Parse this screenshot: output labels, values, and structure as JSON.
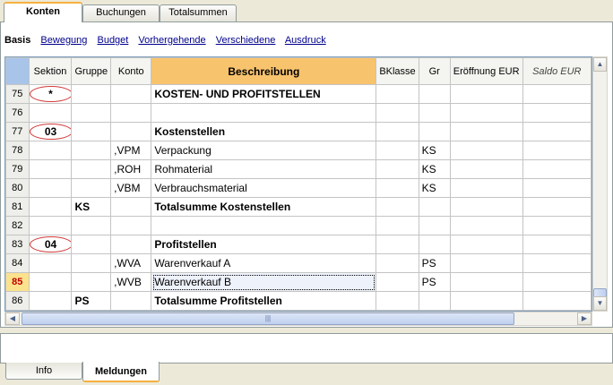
{
  "tabs": [
    {
      "label": "Konten",
      "active": true
    },
    {
      "label": "Buchungen",
      "active": false
    },
    {
      "label": "Totalsummen",
      "active": false
    }
  ],
  "views": {
    "current": "Basis",
    "links": [
      "Bewegung",
      "Budget",
      "Vorhergehende",
      "Verschiedene",
      "Ausdruck"
    ]
  },
  "table": {
    "columns": [
      "Sektion",
      "Gruppe",
      "Konto",
      "Beschreibung",
      "BKlasse",
      "Gr",
      "Eröffnung EUR",
      "Saldo EUR"
    ],
    "rows": [
      {
        "n": "75",
        "sektion": "*",
        "gruppe": "",
        "konto": "",
        "desc": "KOSTEN- UND PROFITSTELLEN",
        "bklasse": "",
        "gr": "",
        "bold": true
      },
      {
        "n": "76",
        "sektion": "",
        "gruppe": "",
        "konto": "",
        "desc": "",
        "bklasse": "",
        "gr": ""
      },
      {
        "n": "77",
        "sektion": "03",
        "gruppe": "",
        "konto": "",
        "desc": "Kostenstellen",
        "bklasse": "",
        "gr": "",
        "bold": true
      },
      {
        "n": "78",
        "sektion": "",
        "gruppe": "",
        "konto": ",VPM",
        "desc": "Verpackung",
        "bklasse": "",
        "gr": "KS"
      },
      {
        "n": "79",
        "sektion": "",
        "gruppe": "",
        "konto": ",ROH",
        "desc": "Rohmaterial",
        "bklasse": "",
        "gr": "KS"
      },
      {
        "n": "80",
        "sektion": "",
        "gruppe": "",
        "konto": ",VBM",
        "desc": "Verbrauchsmaterial",
        "bklasse": "",
        "gr": "KS"
      },
      {
        "n": "81",
        "sektion": "",
        "gruppe": "KS",
        "konto": "",
        "desc": "Totalsumme Kostenstellen",
        "bklasse": "",
        "gr": "",
        "bold": true
      },
      {
        "n": "82",
        "sektion": "",
        "gruppe": "",
        "konto": "",
        "desc": "",
        "bklasse": "",
        "gr": ""
      },
      {
        "n": "83",
        "sektion": "04",
        "gruppe": "",
        "konto": "",
        "desc": "Profitstellen",
        "bklasse": "",
        "gr": "",
        "bold": true
      },
      {
        "n": "84",
        "sektion": "",
        "gruppe": "",
        "konto": ",WVA",
        "desc": "Warenverkauf A",
        "bklasse": "",
        "gr": "PS"
      },
      {
        "n": "85",
        "sektion": "",
        "gruppe": "",
        "konto": ",WVB",
        "desc": "Warenverkauf B",
        "bklasse": "",
        "gr": "PS",
        "selected": true
      },
      {
        "n": "86",
        "sektion": "",
        "gruppe": "PS",
        "konto": "",
        "desc": "Totalsumme Profitstellen",
        "bklasse": "",
        "gr": "",
        "bold": true
      }
    ]
  },
  "scroll_grip": "|||",
  "bottom_tabs": [
    {
      "label": "Info",
      "active": false
    },
    {
      "label": "Meldungen",
      "active": true
    }
  ],
  "colors": {
    "header_active": "#f8c36d",
    "selected_row_number": "#fbe28d",
    "annotation_ellipse": "#d23a3a",
    "link": "#00008b"
  }
}
